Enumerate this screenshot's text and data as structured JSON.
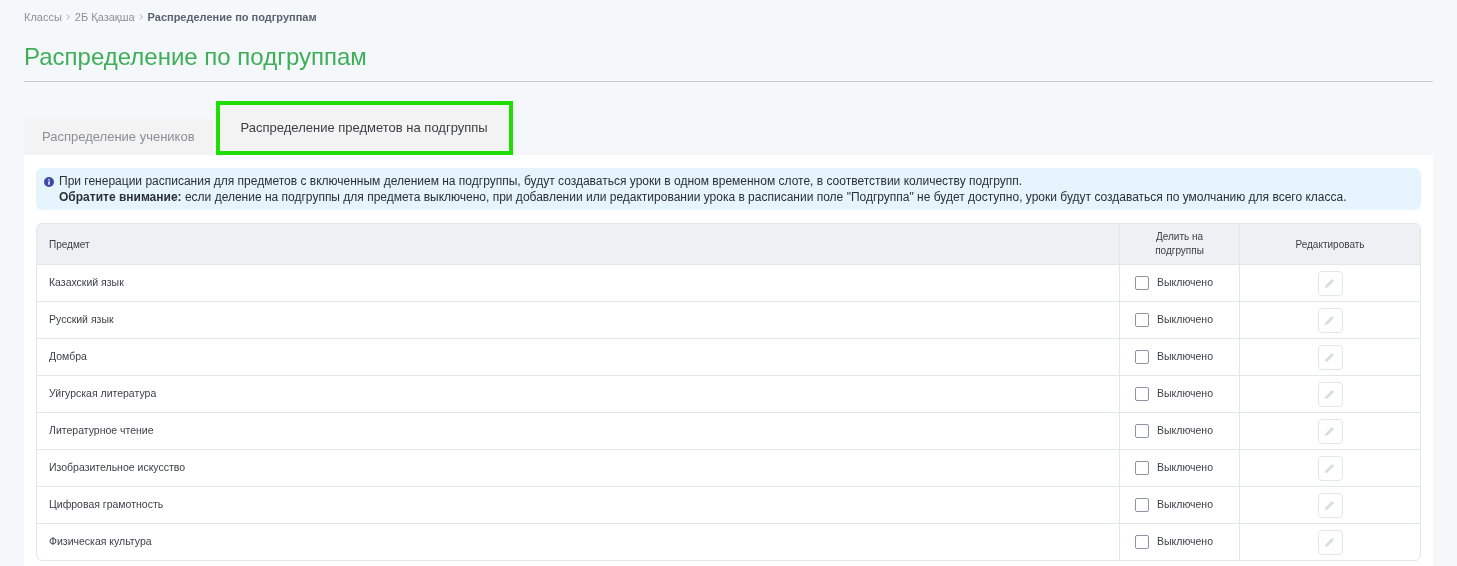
{
  "breadcrumb": [
    {
      "label": "Классы",
      "current": false
    },
    {
      "label": "2Б Қазақша",
      "current": false
    },
    {
      "label": "Распределение по подгруппам",
      "current": true
    }
  ],
  "title": "Распределение по подгруппам",
  "tabs": [
    {
      "label": "Распределение учеников",
      "selected": false
    },
    {
      "label": "Распределение предметов на подгруппы",
      "selected": true
    }
  ],
  "info": {
    "line1": "При генерации расписания для предметов с включенным делением на подгруппы, будут создаваться уроки в одном временном слоте, в соответствии количеству подгрупп.",
    "line2": "**Обратите внимание:** если деление на подгруппы для предмета выключено, при добавлении или редактировании урока в расписании поле \"Подгруппа\" не будет доступно, уроки будут создаваться по умолчанию для всего класса."
  },
  "table": {
    "columns": [
      "Предмет",
      "Делить на подгруппы",
      "Редактировать"
    ],
    "rows": [
      {
        "subject": "Казахский язык",
        "checked": false,
        "status": "Выключено"
      },
      {
        "subject": "Русский язык",
        "checked": false,
        "status": "Выключено"
      },
      {
        "subject": "Домбра",
        "checked": false,
        "status": "Выключено"
      },
      {
        "subject": "Уйгурская литература",
        "checked": false,
        "status": "Выключено"
      },
      {
        "subject": "Литературное чтение",
        "checked": false,
        "status": "Выключено"
      },
      {
        "subject": "Изобразительное искусство",
        "checked": false,
        "status": "Выключено"
      },
      {
        "subject": "Цифровая грамотность",
        "checked": false,
        "status": "Выключено"
      },
      {
        "subject": "Физическая культура",
        "checked": false,
        "status": "Выключено"
      }
    ]
  }
}
